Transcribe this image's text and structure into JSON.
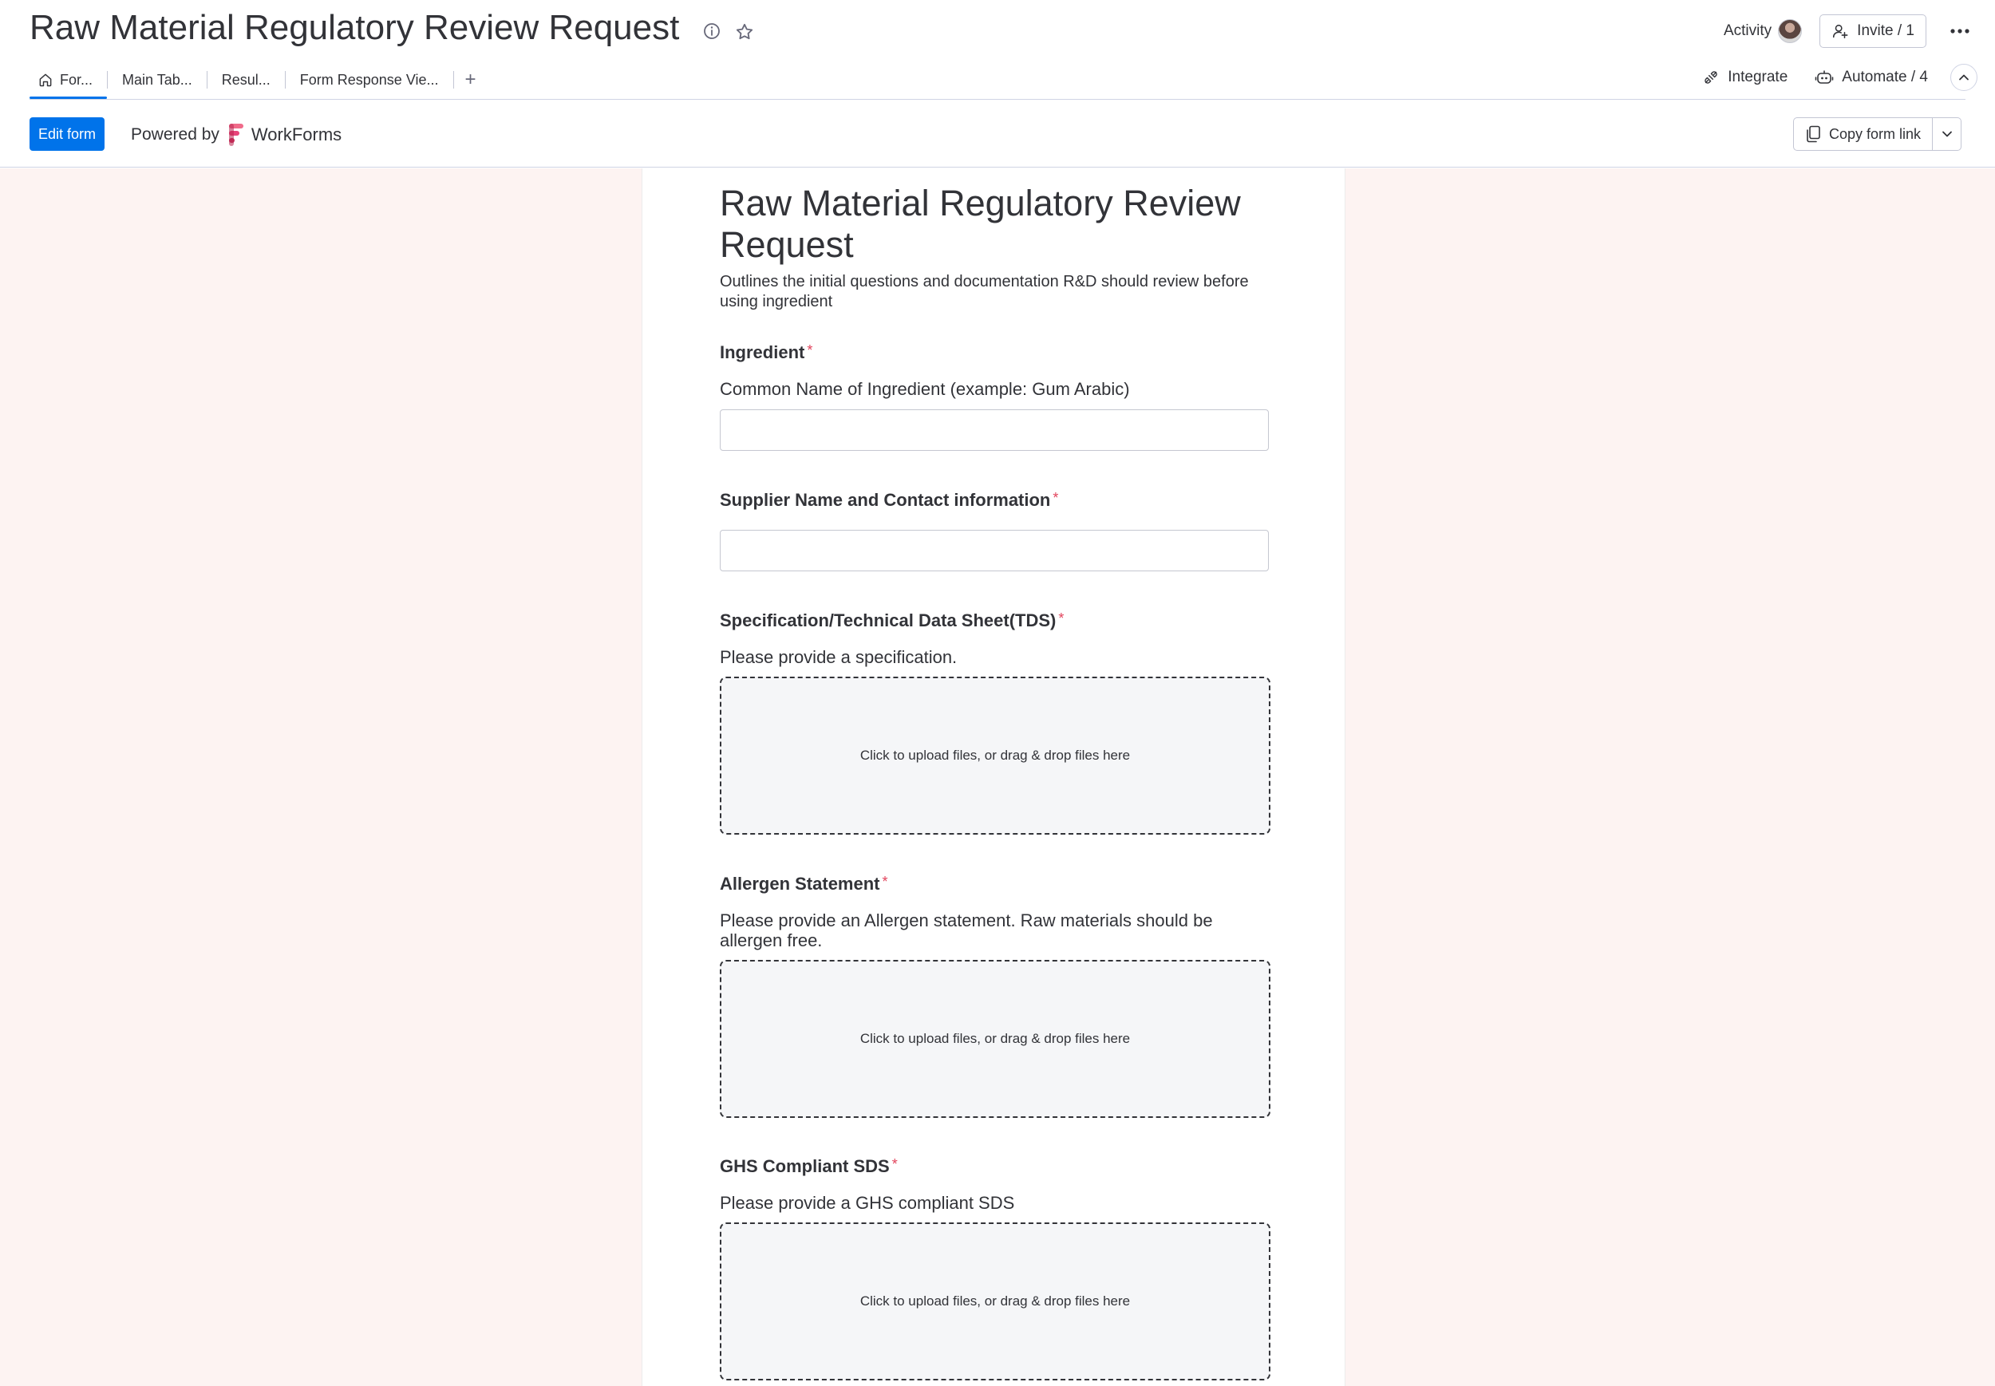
{
  "header": {
    "board_title": "Raw Material Regulatory Review Request",
    "activity_label": "Activity",
    "invite_label": "Invite / 1"
  },
  "tabs": [
    {
      "label": "For..."
    },
    {
      "label": "Main Tab..."
    },
    {
      "label": "Resul..."
    },
    {
      "label": "Form Response Vie..."
    }
  ],
  "tab_add": "+",
  "tabs_right": {
    "integrate_label": "Integrate",
    "automate_label": "Automate / 4"
  },
  "toolbar": {
    "edit_form_label": "Edit form",
    "powered_by": "Powered by",
    "brand": "WorkForms",
    "copy_link_label": "Copy form link"
  },
  "colors": {
    "accent": "#0073ea",
    "required": "#e2445c",
    "canvas_bg": "#fdf3f2"
  },
  "form": {
    "title": "Raw Material Regulatory Review Request",
    "description": "Outlines the initial questions and documentation R&D should review before using ingredient",
    "upload_text": "Click to upload files, or drag & drop files here",
    "required_mark": "*",
    "fields": {
      "ingredient": {
        "label": "Ingredient",
        "help": "Common Name of Ingredient (example: Gum Arabic)",
        "value": ""
      },
      "supplier": {
        "label": "Supplier Name and Contact information",
        "value": ""
      },
      "tds": {
        "label": "Specification/Technical Data Sheet(TDS)",
        "help": "Please provide a specification."
      },
      "allergen": {
        "label": "Allergen Statement",
        "help": "Please provide an Allergen statement. Raw materials should be allergen free."
      },
      "ghs": {
        "label": "GHS Compliant SDS",
        "help": "Please provide a GHS compliant SDS"
      }
    }
  }
}
